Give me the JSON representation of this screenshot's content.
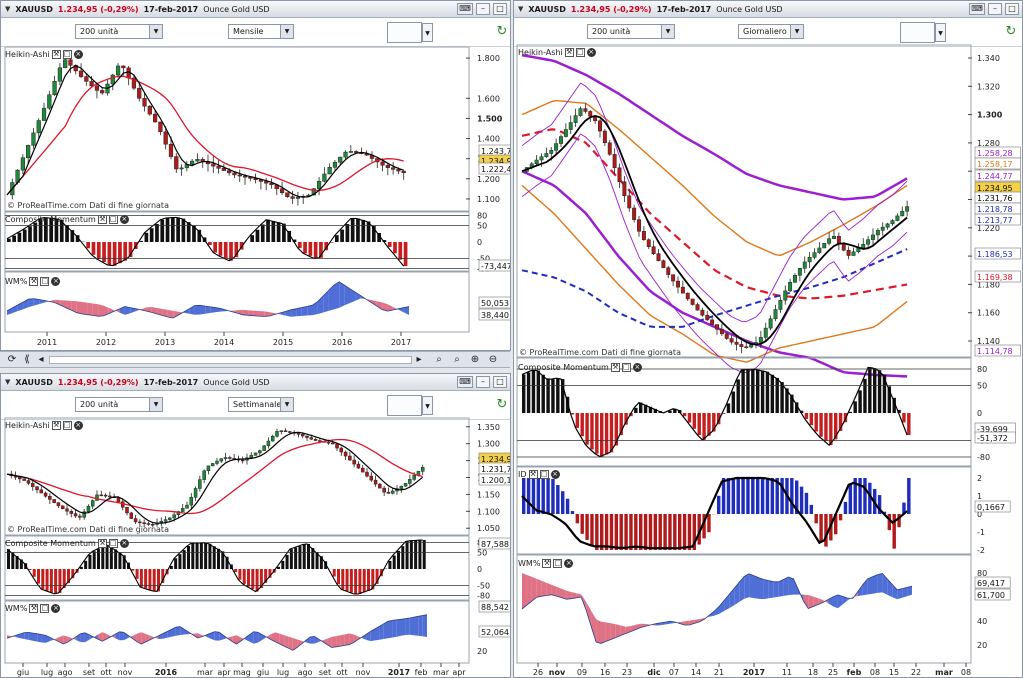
{
  "colors": {
    "up": "#1d8a3a",
    "down": "#b11a1a",
    "ma_red": "#e0162b",
    "ma_black": "#000000",
    "momentum_up": "#111111",
    "momentum_down": "#c41e1e",
    "wm_blue": "#4f6fd6",
    "wm_pink": "#e07286",
    "purple": "#9b1fd0",
    "orange": "#e07818",
    "blue_bars": "#1f2dbd",
    "red_bars": "#b11a1a",
    "accent_change": "#c8001a"
  },
  "symbol": "XAUUSD",
  "last_price": "1.234,95",
  "change": "(-0,29%)",
  "date": "17-feb-2017",
  "instrument": "Ounce Gold USD",
  "units": "200 unità",
  "heikin": "Heikin-Ashi",
  "momentum": "Composite Momentum",
  "wm": "WM%",
  "watermark": "© ProRealTime.com  Dati di fine giornata",
  "win1": {
    "period": "Mensile",
    "price_ticks": [
      "1.800",
      "1.600",
      "1.500",
      "1.400",
      "1.300",
      "1.200",
      "1.100"
    ],
    "price_badges": [
      "1.243,74",
      "1.234,95",
      "1.222,42"
    ],
    "mom_ticks": [
      "80",
      "50",
      "0",
      "-50",
      "-80"
    ],
    "mom_badge": "-73,447",
    "wm_badges": [
      "50,053",
      "38,440"
    ],
    "x_ticks": [
      "2011",
      "2012",
      "2013",
      "2014",
      "2015",
      "2016",
      "2017"
    ]
  },
  "win2": {
    "period": "Settimanale",
    "price_ticks": [
      "1.350",
      "1.300",
      "1.250",
      "1.200",
      "1.150",
      "1.100",
      "1.050"
    ],
    "price_badges": [
      "1.234,95",
      "1.231,78",
      "1.200,13"
    ],
    "mom_ticks": [
      "80",
      "50",
      "0",
      "-50",
      "-80"
    ],
    "mom_badge": "87,588",
    "wm_badges": [
      "88,542",
      "52,064"
    ],
    "wm_ticks": [
      "20"
    ],
    "x_ticks": [
      "giu",
      "lug",
      "ago",
      "set",
      "ott",
      "nov",
      "2016",
      "mar",
      "apr",
      "mag",
      "giu",
      "lug",
      "ago",
      "set",
      "ott",
      "nov",
      "2017",
      "feb",
      "mar",
      "apr"
    ]
  },
  "win3": {
    "period": "Giornaliero",
    "price_ticks": [
      "1.340",
      "1.320",
      "1.300",
      "1.280",
      "1.260",
      "1.240",
      "1.220",
      "1.200",
      "1.180",
      "1.160",
      "1.140"
    ],
    "price_badges": [
      {
        "t": "1.258,28",
        "c": "#9b1fd0"
      },
      {
        "t": "1.258,17",
        "c": "#e07818"
      },
      {
        "t": "1.244,77",
        "c": "#9b1fd0"
      },
      {
        "t": "1.234,95",
        "c": "#f3d04a"
      },
      {
        "t": "1.231,76",
        "c": "#000000"
      },
      {
        "t": "1.218,78",
        "c": "#1f2dbd"
      },
      {
        "t": "1.213,77",
        "c": "#1f2dbd"
      },
      {
        "t": "1.186,53",
        "c": "#1f2dbd"
      },
      {
        "t": "1.169,38",
        "c": "#e0162b"
      },
      {
        "t": "1.114,78",
        "c": "#9b1fd0"
      }
    ],
    "mom_ticks": [
      "80",
      "50",
      "0",
      "-50",
      "-80"
    ],
    "mom_badges": [
      "-39,699",
      "-51,372"
    ],
    "ind_label": "ID",
    "ind_ticks": [
      "2",
      "1",
      "0",
      "-1",
      "-2"
    ],
    "ind_badge": "0,1667",
    "wm_ticks": [
      "80",
      "60",
      "40",
      "20"
    ],
    "wm_badges": [
      "69,417",
      "61,700"
    ],
    "x_ticks": [
      "26",
      "nov",
      "09",
      "16",
      "23",
      "dic",
      "07",
      "14",
      "21",
      "2017",
      "11",
      "18",
      "25",
      "feb",
      "08",
      "15",
      "22",
      "mar",
      "08"
    ]
  }
}
